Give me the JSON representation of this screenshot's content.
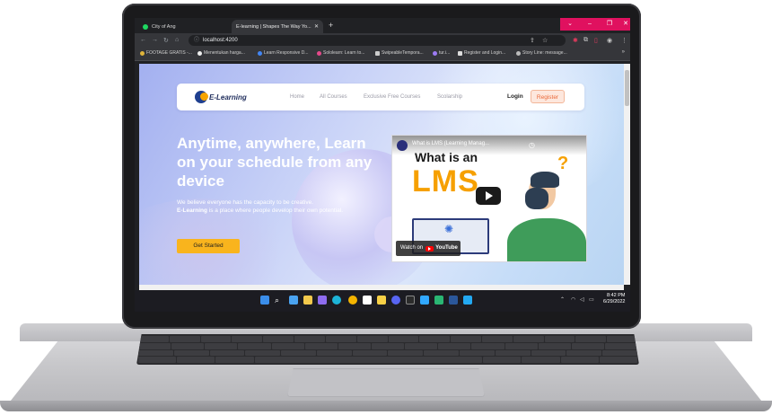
{
  "browser": {
    "tabs": [
      {
        "label": "City of Ang"
      },
      {
        "label": "E-learning | Shapes The Way Yo..."
      }
    ],
    "close_glyph": "✕",
    "new_tab_glyph": "+",
    "url": "localhost:4200",
    "bookmarks": [
      {
        "label": "FOOTAGE GRATIS -..."
      },
      {
        "label": "Menentukan harga..."
      },
      {
        "label": "Learn Responsive D..."
      },
      {
        "label": "Sololearn: Learn to..."
      },
      {
        "label": "SwipeableTempora..."
      },
      {
        "label": "tur.i..."
      },
      {
        "label": "Register and Login..."
      },
      {
        "label": "Story Line: message..."
      }
    ],
    "bookmarks_more": "»"
  },
  "site": {
    "logo_text": "E-Learning",
    "nav": [
      {
        "label": "Home"
      },
      {
        "label": "All Courses"
      },
      {
        "label": "Exclusive Free Courses"
      },
      {
        "label": "Scolarship"
      }
    ],
    "login_label": "Login",
    "register_label": "Register",
    "hero": {
      "title": "Anytime, anywhere, Learn on your schedule from any device",
      "desc_prefix": "We believe everyone has the capacity to be creative.",
      "desc_brand": "E-Learning",
      "desc_suffix": " is a place where people develop their own potential.",
      "cta": "Get Started"
    },
    "video": {
      "title": "What is LMS (Learning Manag...",
      "overlay_line1": "What is an",
      "overlay_line2": "LMS",
      "watch_prefix": "Watch on",
      "watch_brand": "YouTube"
    }
  },
  "taskbar": {
    "time": "8:42 PM",
    "date": "6/29/2022"
  },
  "colors": {
    "accent": "#f9b41d",
    "register_text": "#ea6a3a",
    "window_controls": "#e0115f"
  }
}
